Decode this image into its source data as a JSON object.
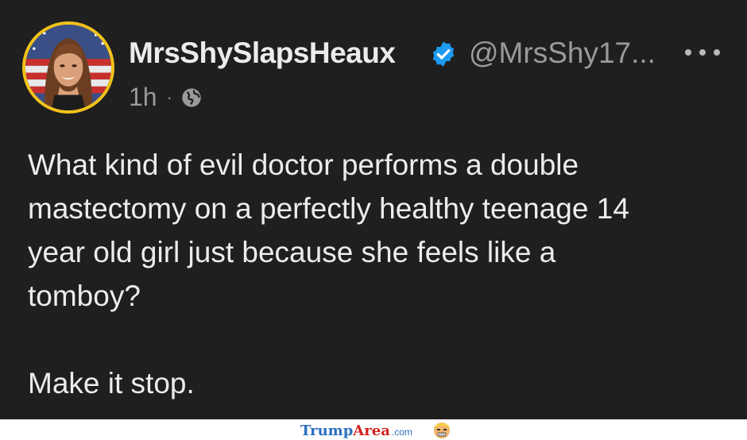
{
  "post": {
    "display_name": "MrsShySlapsHeaux",
    "handle": "@MrsShy17...",
    "timestamp": "1h",
    "separator": "·",
    "visibility_icon": "globe-icon",
    "verified_icon": "verified-badge-icon",
    "more_icon": "more-options-icon",
    "body_lines": [
      "What kind of evil doctor performs a double",
      "mastectomy on a perfectly healthy teenage 14",
      "year old girl just because she feels like a",
      "tomboy?"
    ],
    "body_closing": "Make it stop."
  },
  "footer": {
    "brand_trump": "Trump",
    "brand_area": "Area",
    "brand_tld": ".com",
    "mascot_icon": "trump-cartoon-icon"
  },
  "colors": {
    "background": "#1f1f1f",
    "text": "#ececec",
    "muted": "#9a9a9a",
    "verified": "#1d9bf0",
    "avatar_ring": "#f2c21a"
  }
}
